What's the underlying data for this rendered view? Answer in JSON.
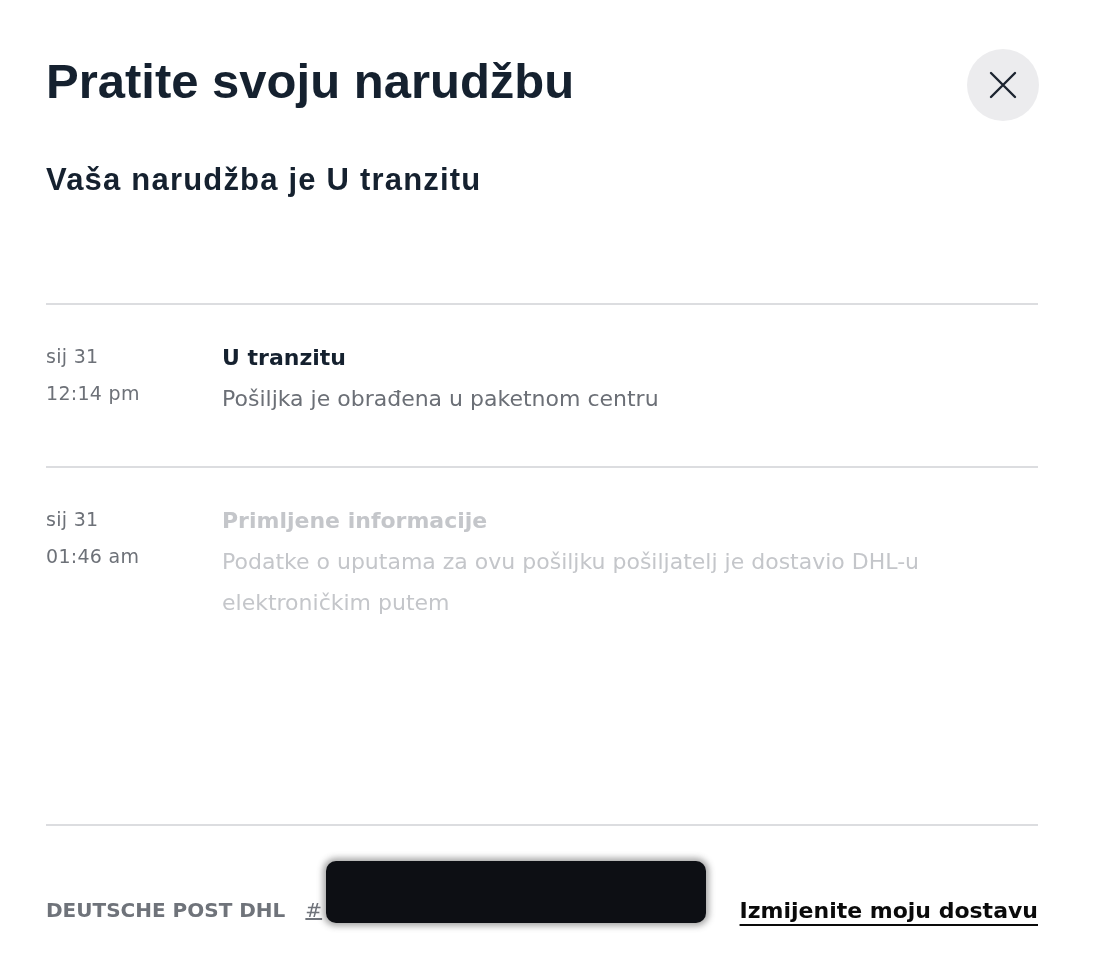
{
  "title": "Pratite svoju narudžbu",
  "subtitle": "Vaša narudžba je U tranzitu",
  "events": [
    {
      "date": "sij 31",
      "time": "12:14 pm",
      "title": "U tranzitu",
      "description": "Pošiljka je obrađena u paketnom centru",
      "active": true
    },
    {
      "date": "sij 31",
      "time": "01:46 am",
      "title": "Primljene informacije",
      "description": "Podatke o uputama za ovu pošiljku pošiljatelj je dostavio DHL-u elektroničkim putem",
      "active": false
    }
  ],
  "footer": {
    "carrier": "DEUTSCHE POST DHL",
    "tracking_number": "#",
    "redacted": true,
    "link": "Izmijenite moju dostavu"
  }
}
